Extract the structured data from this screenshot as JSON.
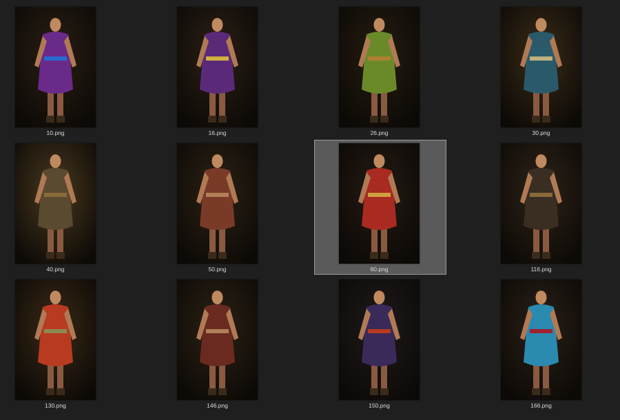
{
  "viewer": {
    "selected_index": 6,
    "colors": {
      "background": "#1f1f1f",
      "selection_fill": "#5a5a5a",
      "selection_border": "#9a9a9a",
      "label_text": "#dcdcdc"
    }
  },
  "files": [
    {
      "name": "10.png",
      "figure": "queen-purple-gown-crown",
      "bg": "#2a1f14",
      "robe": "#6a2a8a",
      "accent": "#2a6ad0"
    },
    {
      "name": "16.png",
      "figure": "queen-purple-gown-tiara",
      "bg": "#2b2016",
      "robe": "#5a2a78",
      "accent": "#d0b040"
    },
    {
      "name": "26.png",
      "figure": "woman-green-dress-fan",
      "bg": "#241c10",
      "robe": "#6a8a2a",
      "accent": "#b08030"
    },
    {
      "name": "30.png",
      "figure": "woman-blue-vest",
      "bg": "#3a2c18",
      "robe": "#2a5a6a",
      "accent": "#c0b080"
    },
    {
      "name": "40.png",
      "figure": "warrior-armor-arms-crossed",
      "bg": "#4a3a20",
      "robe": "#5a4a30",
      "accent": "#8a6a3a"
    },
    {
      "name": "50.png",
      "figure": "shirtless-fighter-cap",
      "bg": "#2c2214",
      "robe": "#7a3a28",
      "accent": "#b08058"
    },
    {
      "name": "60.png",
      "figure": "red-haired-warrior-woman",
      "bg": "#241a14",
      "robe": "#a82a20",
      "accent": "#d0a040"
    },
    {
      "name": "116.png",
      "figure": "warrior-armor-arms-crossed-2",
      "bg": "#2e2418",
      "robe": "#3a2e22",
      "accent": "#8a6a3a"
    },
    {
      "name": "130.png",
      "figure": "elder-red-robe-seated",
      "bg": "#3a2a16",
      "robe": "#b83a20",
      "accent": "#8a8a50"
    },
    {
      "name": "146.png",
      "figure": "shirtless-fighter-cap-2",
      "bg": "#2c2214",
      "robe": "#6a2a20",
      "accent": "#b08058"
    },
    {
      "name": "150.png",
      "figure": "man-purple-tunic",
      "bg": "#1e1a1a",
      "robe": "#3a2a5a",
      "accent": "#b83a20"
    },
    {
      "name": "166.png",
      "figure": "ice-armor-knight",
      "bg": "#2a2018",
      "robe": "#2a8ab0",
      "accent": "#a02030"
    }
  ]
}
